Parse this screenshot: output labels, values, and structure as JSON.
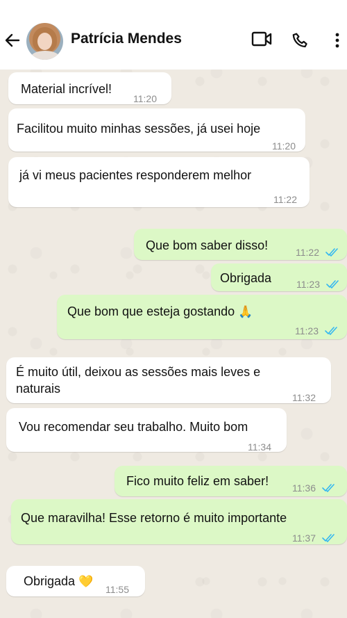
{
  "header": {
    "contact_name": "Patrícia Mendes",
    "icons": [
      "arrow-left-icon",
      "video-camera-icon",
      "phone-icon",
      "more-vertical-icon"
    ]
  },
  "colors": {
    "incoming_bubble": "#ffffff",
    "outgoing_bubble": "#dcf8c6",
    "read_ticks": "#34b7f1",
    "time_text": "#8c8c8c"
  },
  "messages": [
    {
      "direction": "in",
      "text": "Material incrível!",
      "time": "11:20"
    },
    {
      "direction": "in",
      "text": "Facilitou muito minhas sessões, já usei hoje",
      "time": "11:20"
    },
    {
      "direction": "in",
      "text": "já vi meus pacientes responderem melhor",
      "time": "11:22"
    },
    {
      "direction": "out",
      "text": "Que bom saber disso!",
      "time": "11:22",
      "status": "read"
    },
    {
      "direction": "out",
      "text": "Obrigada",
      "time": "11:23",
      "status": "read"
    },
    {
      "direction": "out",
      "text": "Que bom que esteja gostando",
      "emoji": "🙏",
      "time": "11:23",
      "status": "read"
    },
    {
      "direction": "in",
      "text": "É muito útil, deixou as sessões mais leves e naturais",
      "time": "11:32"
    },
    {
      "direction": "in",
      "text": "Vou recomendar seu trabalho. Muito bom",
      "time": "11:34"
    },
    {
      "direction": "out",
      "text": "Fico muito feliz em saber!",
      "time": "11:36",
      "status": "read"
    },
    {
      "direction": "out",
      "text": "Que maravilha! Esse retorno é muito importante",
      "time": "11:37",
      "status": "read"
    },
    {
      "direction": "in",
      "text": "Obrigada",
      "emoji": "💛",
      "time": "11:55"
    }
  ]
}
